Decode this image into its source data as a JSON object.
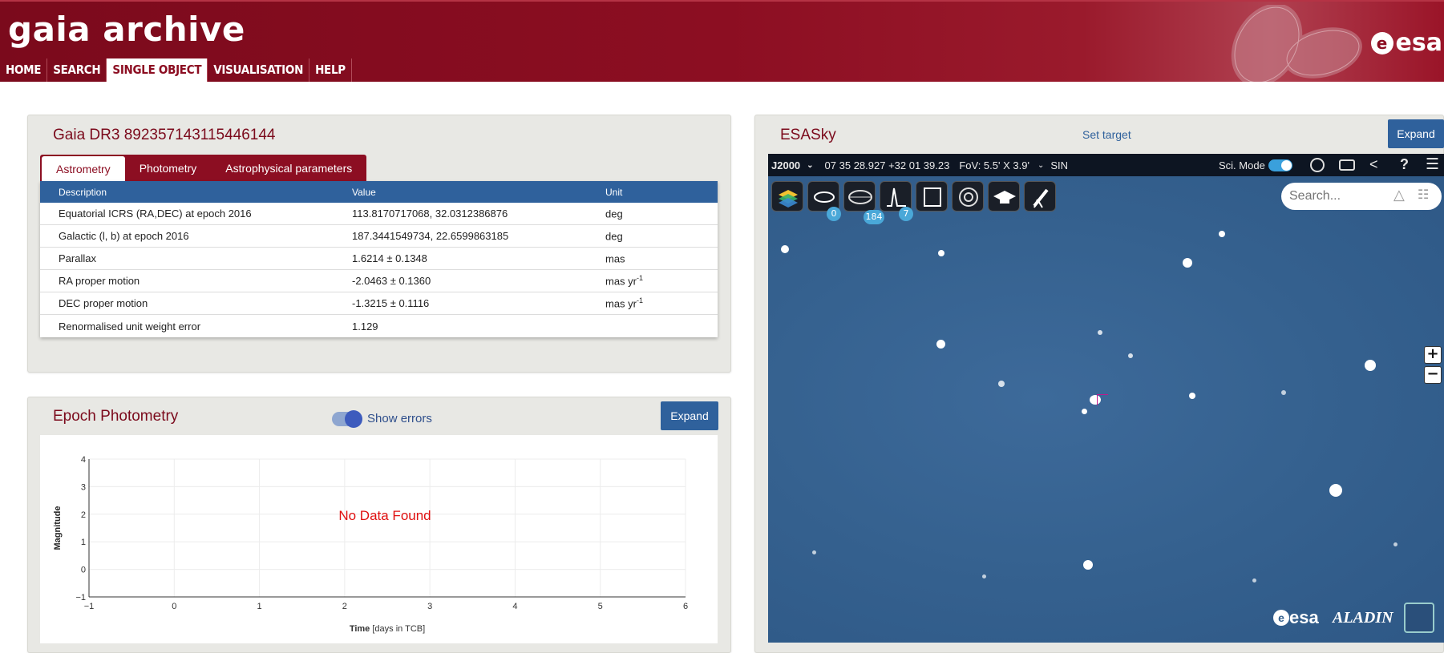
{
  "header": {
    "title": "gaia archive",
    "brand": "esa",
    "nav": [
      "HOME",
      "SEARCH",
      "SINGLE OBJECT",
      "VISUALISATION",
      "HELP"
    ],
    "active_nav": "SINGLE OBJECT"
  },
  "object": {
    "title": "Gaia DR3 892357143115446144",
    "tabs": [
      "Astrometry",
      "Photometry",
      "Astrophysical parameters"
    ],
    "active_tab": "Astrometry",
    "columns": [
      "Description",
      "Value",
      "Unit"
    ],
    "rows": [
      {
        "desc": "Equatorial ICRS (RA,DEC) at epoch 2016",
        "value": "113.8170717068, 32.0312386876",
        "unit": "deg",
        "sup": ""
      },
      {
        "desc": "Galactic (l, b) at epoch 2016",
        "value": "187.3441549734, 22.6599863185",
        "unit": "deg",
        "sup": ""
      },
      {
        "desc": "Parallax",
        "value": "1.6214 ± 0.1348",
        "unit": "mas",
        "sup": ""
      },
      {
        "desc": "RA proper motion",
        "value": "-2.0463 ± 0.1360",
        "unit": "mas yr",
        "sup": "-1"
      },
      {
        "desc": "DEC proper motion",
        "value": "-1.3215 ± 0.1116",
        "unit": "mas yr",
        "sup": "-1"
      },
      {
        "desc": "Renormalised unit weight error",
        "value": "1.129",
        "unit": "",
        "sup": ""
      }
    ]
  },
  "epoch": {
    "title": "Epoch Photometry",
    "toggle_label": "Show errors",
    "toggle_on": true,
    "expand_label": "Expand",
    "no_data": "No Data Found"
  },
  "chart_data": {
    "type": "scatter",
    "series": [],
    "xlabel_bold": "Time",
    "xlabel_rest": " [days in TCB]",
    "ylabel": "Magnitude",
    "xlim": [
      -1,
      6
    ],
    "ylim": [
      -1,
      4
    ],
    "x_ticks": [
      "−1",
      "0",
      "1",
      "2",
      "3",
      "4",
      "5",
      "6"
    ],
    "y_ticks": [
      "4",
      "3",
      "2",
      "1",
      "0",
      "−1"
    ],
    "grid": true
  },
  "esasky": {
    "title": "ESASky",
    "set_target": "Set target",
    "expand_label": "Expand",
    "coord_frame": "J2000",
    "coords": "07 35 28.927 +32 01 39.23",
    "fov": "FoV: 5.5' X 3.9'",
    "projection": "SIN",
    "sci_mode": "Sci. Mode",
    "search_placeholder": "Search...",
    "badges": [
      "0",
      "184",
      "7"
    ],
    "footer_logo": "esa",
    "footer_logo2": "ALADIN"
  }
}
